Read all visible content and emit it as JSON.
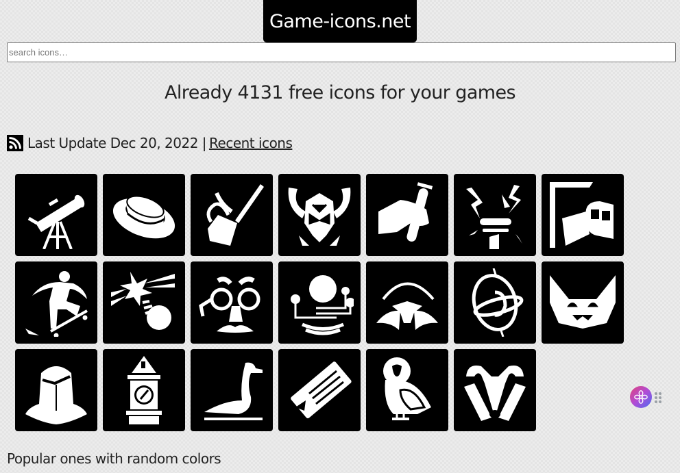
{
  "site": {
    "logo_text": "Game-icons.net"
  },
  "search": {
    "placeholder": "search icons…",
    "value": ""
  },
  "headline": "Already 4131 free icons for your games",
  "update": {
    "rss_icon": "rss-feed-icon",
    "text": "Last Update Dec 20, 2022 |",
    "recent_link": "Recent icons"
  },
  "icons": [
    {
      "name": "telescope-icon"
    },
    {
      "name": "boater-hat-icon"
    },
    {
      "name": "oil-can-icon"
    },
    {
      "name": "horned-helm-icon"
    },
    {
      "name": "hand-test-tube-icon"
    },
    {
      "name": "electric-torch-icon"
    },
    {
      "name": "subway-tunnel-icon"
    },
    {
      "name": "skateboarder-icon"
    },
    {
      "name": "comet-impact-icon"
    },
    {
      "name": "groucho-disguise-icon"
    },
    {
      "name": "robot-orb-icon"
    },
    {
      "name": "mole-icon"
    },
    {
      "name": "gyroscope-icon"
    },
    {
      "name": "goblin-face-icon"
    },
    {
      "name": "knight-helmet-icon"
    },
    {
      "name": "clock-tower-icon"
    },
    {
      "name": "swan-icon"
    },
    {
      "name": "plane-ticket-icon"
    },
    {
      "name": "barn-owl-icon"
    },
    {
      "name": "badger-icon"
    }
  ],
  "popular_heading": "Popular ones with random colors",
  "widget": {
    "icon": "assistant-flower-icon",
    "handle_icon": "drag-handle-icon"
  }
}
